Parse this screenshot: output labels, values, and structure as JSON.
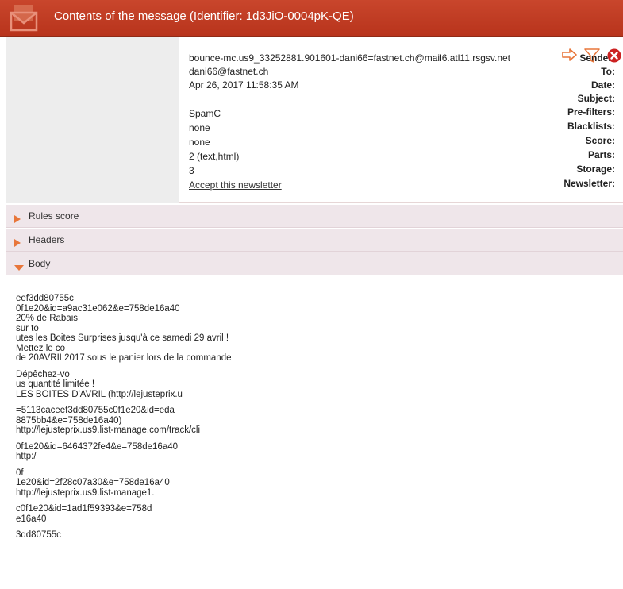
{
  "header": {
    "title": "Contents of the message (Identifier: 1d3JiO-0004pK-QE)"
  },
  "details": {
    "rows": [
      {
        "label": "Sender:",
        "value": "bounce-mc.us9_33252881.901601-dani66=fastnet.ch@mail6.atl11.rsgsv.net"
      },
      {
        "label": "To:",
        "value": "dani66@fastnet.ch"
      },
      {
        "label": "Date:",
        "value": "Apr 26, 2017 11:58:35 AM"
      },
      {
        "label": "Subject:",
        "value": ""
      },
      {
        "label": "Pre-filters:",
        "value": "SpamC"
      },
      {
        "label": "Blacklists:",
        "value": "none"
      },
      {
        "label": "Score:",
        "value": "none"
      },
      {
        "label": "Parts:",
        "value": "2 (text,html)"
      },
      {
        "label": "Storage:",
        "value": "3"
      },
      {
        "label": "Newsletter:",
        "value": "Accept this newsletter"
      }
    ]
  },
  "sections": {
    "rules_score": "Rules score",
    "headers": "Headers",
    "body": "Body"
  },
  "icons": {
    "title": "envelope-icon",
    "forward": "forward-arrow-icon",
    "filter": "filter-icon",
    "close": "close-circle-icon"
  },
  "colors": {
    "titlebar": "#c0402a",
    "accent_orange": "#e8763a",
    "close_red": "#cc2222"
  },
  "body": {
    "lines": [
      "eef3dd80755c",
      "0f1e20&id=a9ac31e062&e=758de16a40",
      "20% de Rabais",
      "sur to",
      "utes les Boites Surprises jusqu'à ce samedi 29 avril !",
      "Mettez le co",
      "de 20AVRIL2017 sous le panier lors de la commande",
      "",
      "Dépêchez-vo",
      "us quantité limitée !",
      "LES BOITES D'AVRIL (http://lejusteprix.u",
      "",
      "=5113caceef3dd80755c0f1e20&id=eda",
      "8875bb4&e=758de16a40)",
      "http://lejusteprix.us9.list-manage.com/track/cli",
      "",
      "0f1e20&id=6464372fe4&e=758de16a40",
      "http:/",
      "",
      "0f",
      "1e20&id=2f28c07a30&e=758de16a40",
      "http://lejusteprix.us9.list-manage1.",
      "",
      "c0f1e20&id=1ad1f59393&e=758d",
      "e16a40",
      "",
      "3dd80755c"
    ]
  }
}
